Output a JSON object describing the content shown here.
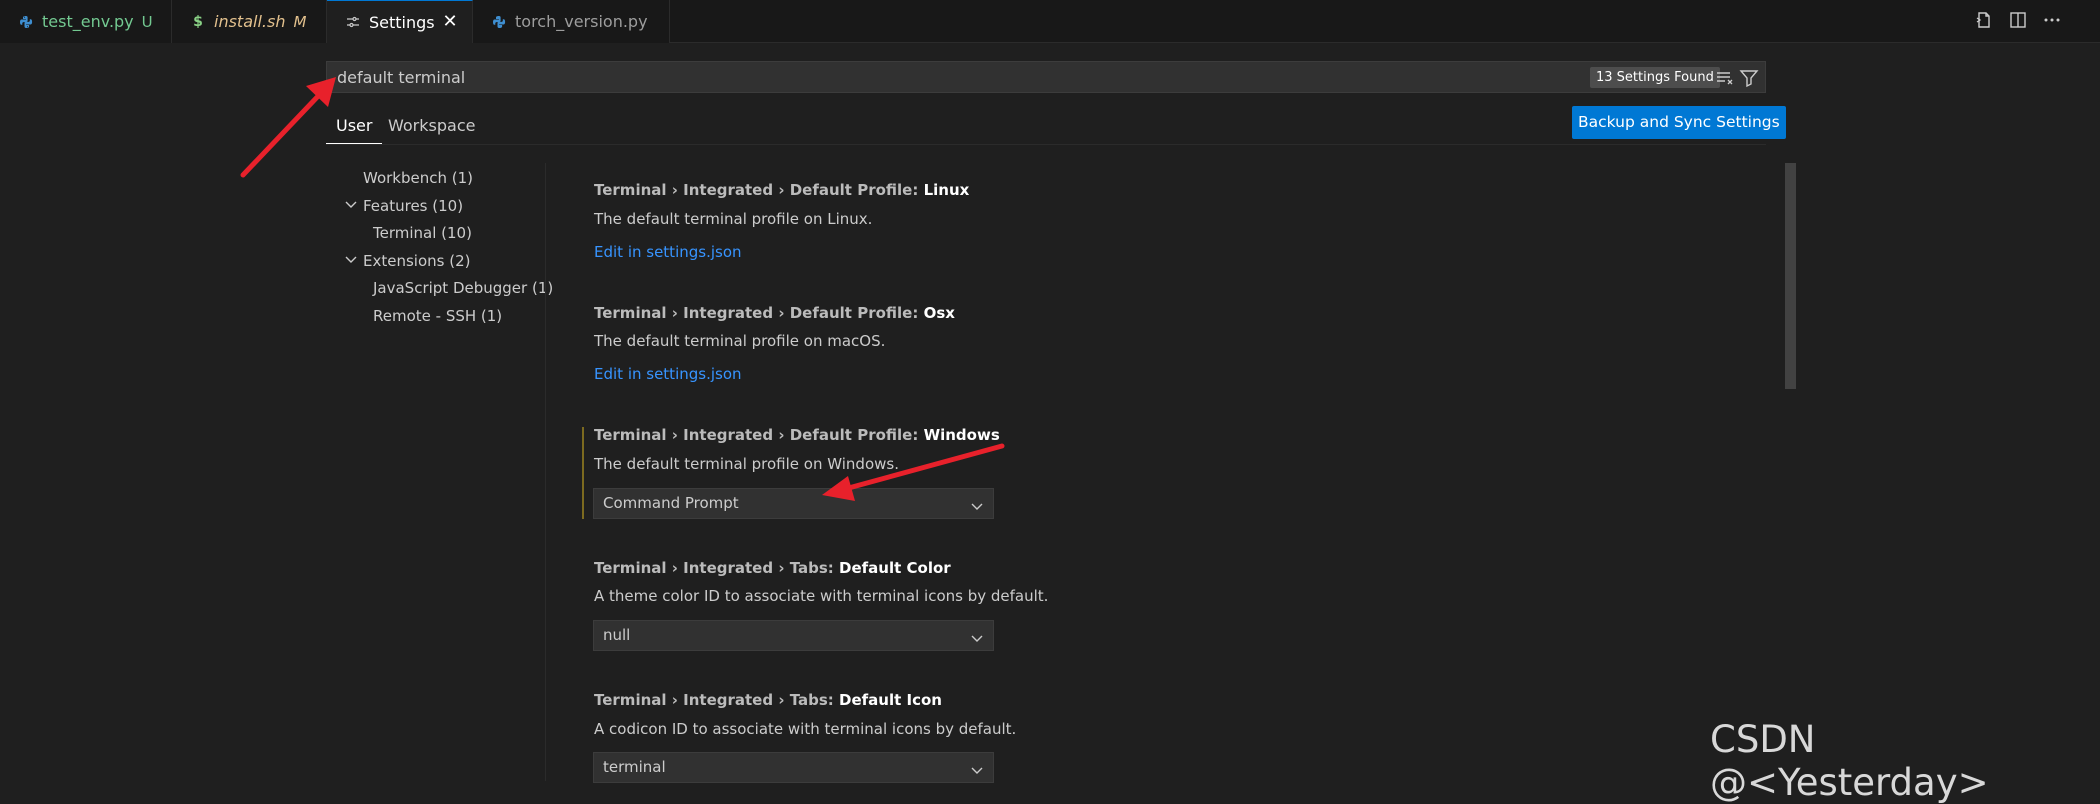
{
  "tabs": [
    {
      "label": "test_env.py",
      "badge": "U",
      "icon": "python-icon",
      "label_color": "#73c991",
      "badge_color": "#73c991"
    },
    {
      "label": "install.sh",
      "badge": "M",
      "icon": "dollar-icon",
      "label_color": "#e2c08d",
      "badge_color": "#e2c08d"
    },
    {
      "label": "Settings",
      "icon": "settings-icon",
      "close": "✕"
    },
    {
      "label": "torch_version.py",
      "icon": "python-icon"
    }
  ],
  "search": {
    "value": "default terminal",
    "found": "13 Settings Found"
  },
  "scope_tabs": [
    {
      "label": "User"
    },
    {
      "label": "Workspace"
    }
  ],
  "sync_button": "Backup and Sync Settings",
  "toc": [
    {
      "label": "Workbench (1)"
    },
    {
      "label": "Features (10)"
    },
    {
      "label": "Terminal (10)"
    },
    {
      "label": "Extensions (2)"
    },
    {
      "label": "JavaScript Debugger (1)"
    },
    {
      "label": "Remote - SSH (1)"
    }
  ],
  "settings": [
    {
      "prefix": "Terminal › Integrated › Default Profile: ",
      "key": "Linux",
      "description": "The default terminal profile on Linux.",
      "link": "Edit in settings.json"
    },
    {
      "prefix": "Terminal › Integrated › Default Profile: ",
      "key": "Osx",
      "description": "The default terminal profile on macOS.",
      "link": "Edit in settings.json"
    },
    {
      "prefix": "Terminal › Integrated › Default Profile: ",
      "key": "Windows",
      "description": "The default terminal profile on Windows.",
      "value": "Command Prompt"
    },
    {
      "prefix": "Terminal › Integrated › Tabs: ",
      "key": "Default Color",
      "description": "A theme color ID to associate with terminal icons by default.",
      "value": "null"
    },
    {
      "prefix": "Terminal › Integrated › Tabs: ",
      "key": "Default Icon",
      "description": "A codicon ID to associate with terminal icons by default.",
      "value": "terminal"
    }
  ],
  "colors": {
    "accent": "#0078d4",
    "link": "#3794ff",
    "annotation_arrow": "#e8212b"
  },
  "watermark": "CSDN @<Yesterday>"
}
